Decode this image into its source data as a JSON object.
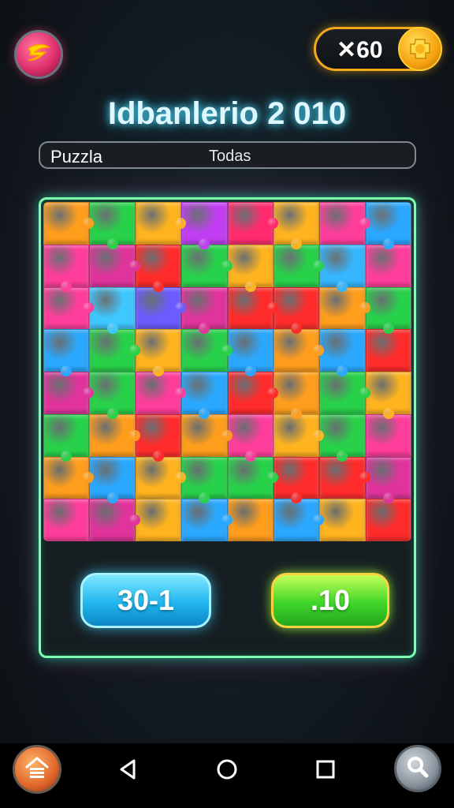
{
  "header": {
    "title": "Idbanlerio 2 010",
    "coins": "✕60",
    "menu_icon": "star-swirl-icon",
    "coin_icon": "gold-puzzle-coin-icon"
  },
  "info_bar": {
    "left_label": "Puzzla",
    "right_label": "Todas"
  },
  "board": {
    "rows": [
      [
        "#ff9d1c",
        "#28d14a",
        "#ffb31f",
        "#c13ef2",
        "#ff2b6e",
        "#ffb31f",
        "#ff3d9b",
        "#2aa8ff"
      ],
      [
        "#ff3d9b",
        "#e0349c",
        "#ff2b2b",
        "#28d14a",
        "#ffb31f",
        "#28d14a",
        "#35b6ff",
        "#ff3d9b"
      ],
      [
        "#ff3d9b",
        "#3fc8ff",
        "#6a5cff",
        "#e0349c",
        "#ff2b2b",
        "#ff2b2b",
        "#ff9d1c",
        "#28d14a"
      ],
      [
        "#2aa8ff",
        "#28d14a",
        "#ffb31f",
        "#28d14a",
        "#2aa8ff",
        "#ff9d1c",
        "#2aa8ff",
        "#ff2b2b"
      ],
      [
        "#e0349c",
        "#28d14a",
        "#ff3d9b",
        "#2aa8ff",
        "#ff2b2b",
        "#ff9d1c",
        "#28d14a",
        "#ffb31f"
      ],
      [
        "#28d14a",
        "#ff9d1c",
        "#ff2b2b",
        "#ff9d1c",
        "#ff3d9b",
        "#ffb31f",
        "#28d14a",
        "#ff3d9b"
      ],
      [
        "#ff9d1c",
        "#2aa8ff",
        "#ffb31f",
        "#28d14a",
        "#28d14a",
        "#ff2b2b",
        "#ff2b2b",
        "#e0349c"
      ],
      [
        "#ff3d9b",
        "#e0349c",
        "#ffb31f",
        "#2aa8ff",
        "#ff9d1c",
        "#2aa8ff",
        "#ffb31f",
        "#ff2b2b"
      ]
    ]
  },
  "buttons": {
    "left_label": "30-1",
    "right_label": ".10"
  },
  "nav": {
    "home_icon": "home-icon",
    "back_icon": "back-triangle-icon",
    "home_circle_icon": "circle-home-icon",
    "recents_icon": "recents-square-icon",
    "search_icon": "magnifier-icon"
  },
  "colors": {
    "accent_green": "#7dffb0",
    "accent_gold": "#f3a81c",
    "title_glow": "#4ee0ff"
  }
}
